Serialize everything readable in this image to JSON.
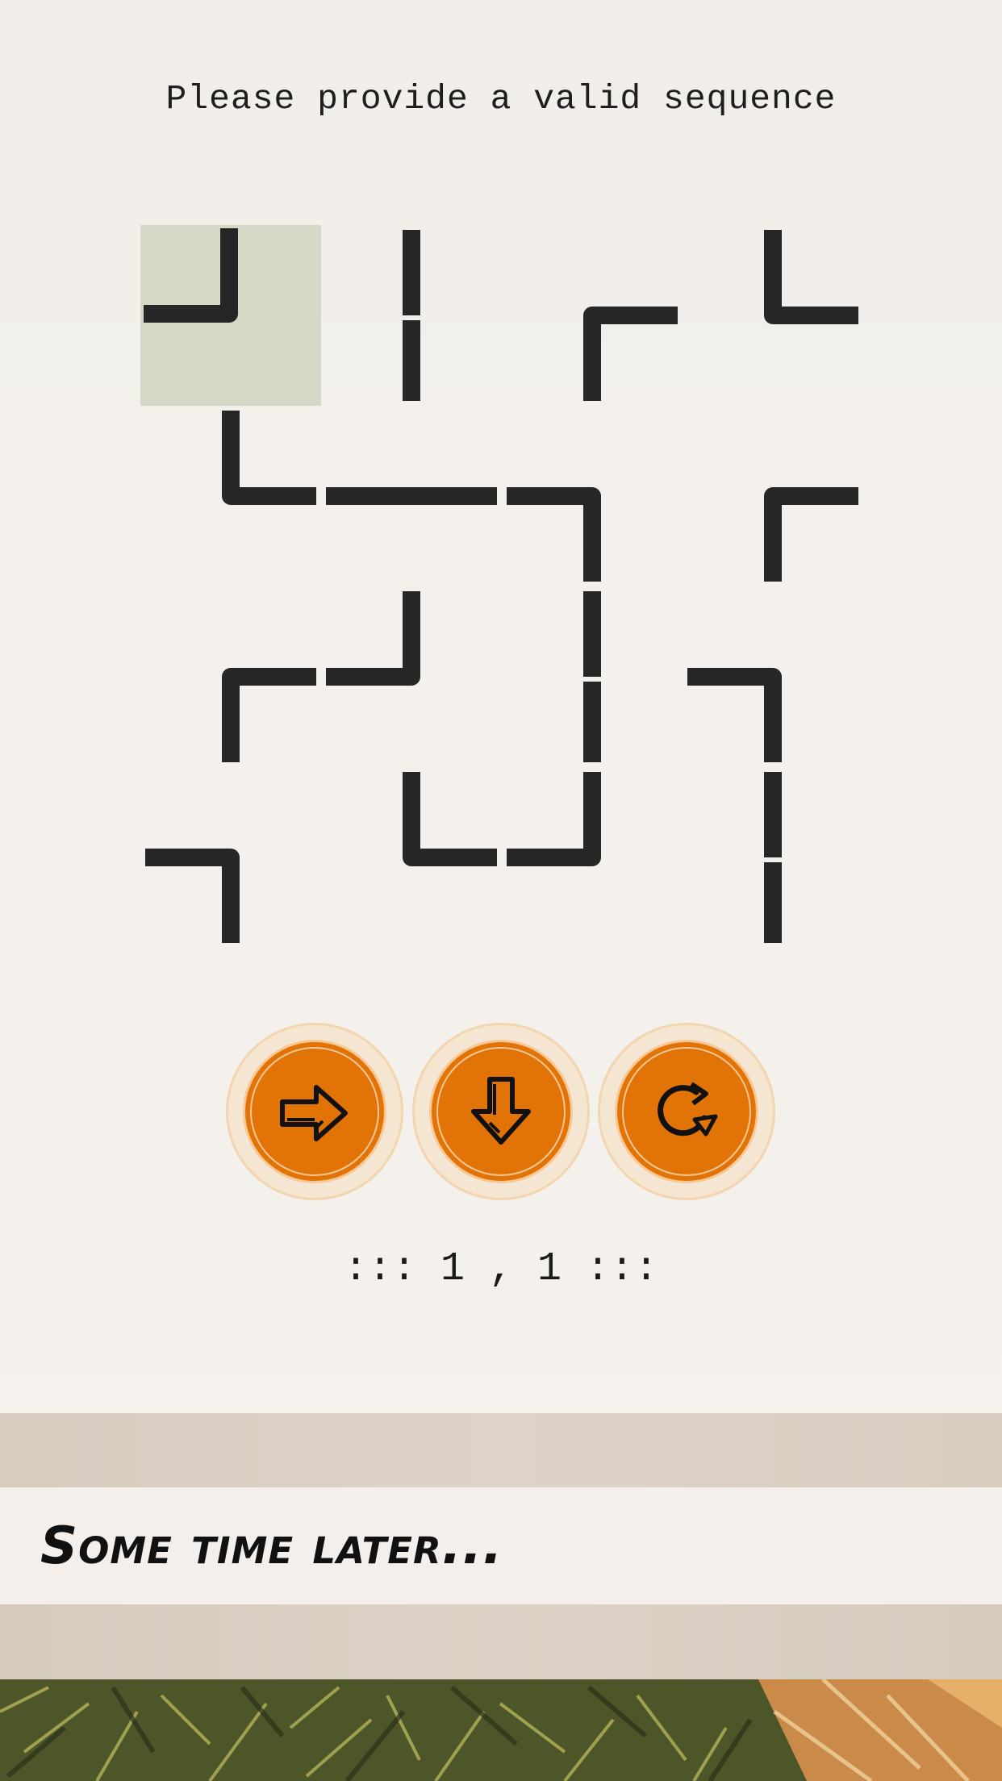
{
  "prompt": "Please provide a valid sequence",
  "grid": {
    "rows": 4,
    "cols": 4,
    "selected": [
      0,
      0
    ],
    "tiles": [
      [
        "TL",
        "NS",
        "ES",
        "NE"
      ],
      [
        "NE",
        "EW",
        "WS",
        "ES"
      ],
      [
        "ES",
        "NW",
        "NS",
        "WS"
      ],
      [
        "WS",
        "NE",
        "NW",
        "NS"
      ]
    ]
  },
  "controls": {
    "move_right": "arrow-right-icon",
    "move_down": "arrow-down-icon",
    "rotate": "rotate-icon"
  },
  "position": {
    "row": "1",
    "col": "1",
    "text": "::: 1 , 1 :::"
  },
  "caption": "Some time later...",
  "colors": {
    "background": "#f2efea",
    "selected_tile": "#d5d8c5",
    "pipe": "#262626",
    "button": "#e27407",
    "button_ring": "#f7c893"
  }
}
